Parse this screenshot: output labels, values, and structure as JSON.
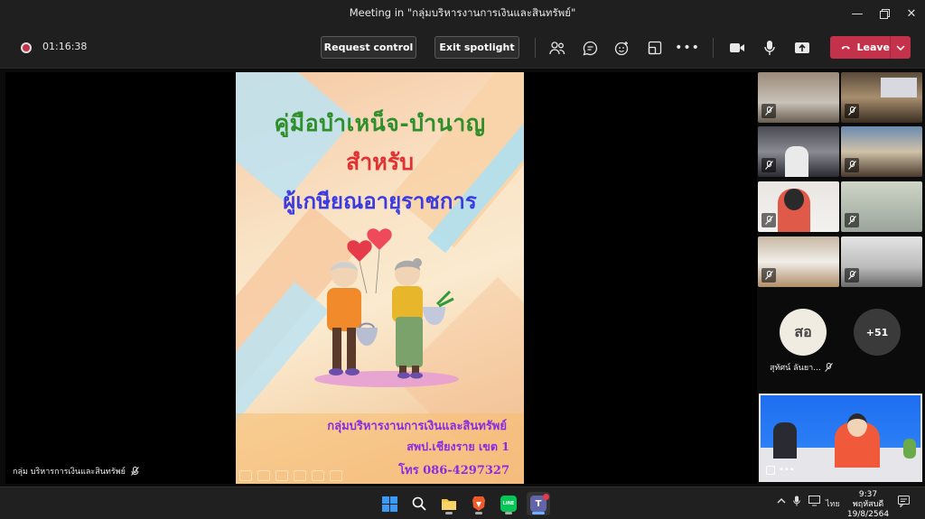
{
  "window": {
    "title": "Meeting in \"กลุ่มบริหารงานการเงินและสินทรัพย์\""
  },
  "toolbar": {
    "timer": "01:16:38",
    "request_control_label": "Request control",
    "exit_spotlight_label": "Exit spotlight",
    "leave_label": "Leave"
  },
  "slide": {
    "title_line1": "คู่มือบำเหน็จ-บำนาญ",
    "title_line2": "สำหรับ",
    "title_line3": "ผู้เกษียณอายุราชการ",
    "footer_org": "กลุ่มบริหารงานการเงินและสินทรัพย์",
    "footer_office": "สพป.เชียงราย เขต 1",
    "footer_phone": "โทร 086-4297327"
  },
  "presenter": {
    "name": "กลุ่ม บริหารการเงินและสินทรัพย์"
  },
  "gallery": {
    "avatar_initials": "สอ",
    "avatar_name": "สุทัศน์ ลันยา...",
    "overflow_count": "+51"
  },
  "taskbar": {
    "lang": "ไทย",
    "time": "9:37",
    "day": "พฤหัสบดี",
    "date": "19/8/2564"
  },
  "colors": {
    "leave": "#c4314b",
    "accent": "#6264a7",
    "titlebar": "#1f1f1f"
  }
}
